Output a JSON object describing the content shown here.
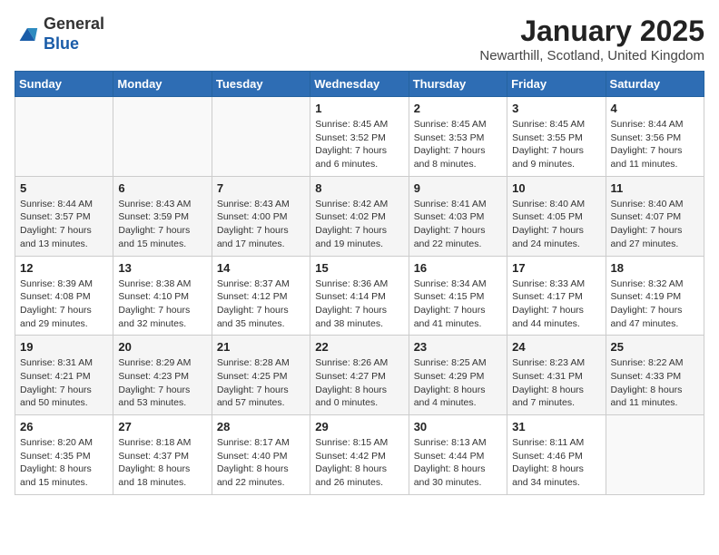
{
  "logo": {
    "general": "General",
    "blue": "Blue"
  },
  "title": "January 2025",
  "location": "Newarthill, Scotland, United Kingdom",
  "weekdays": [
    "Sunday",
    "Monday",
    "Tuesday",
    "Wednesday",
    "Thursday",
    "Friday",
    "Saturday"
  ],
  "weeks": [
    [
      {
        "day": "",
        "info": ""
      },
      {
        "day": "",
        "info": ""
      },
      {
        "day": "",
        "info": ""
      },
      {
        "day": "1",
        "info": "Sunrise: 8:45 AM\nSunset: 3:52 PM\nDaylight: 7 hours and 6 minutes."
      },
      {
        "day": "2",
        "info": "Sunrise: 8:45 AM\nSunset: 3:53 PM\nDaylight: 7 hours and 8 minutes."
      },
      {
        "day": "3",
        "info": "Sunrise: 8:45 AM\nSunset: 3:55 PM\nDaylight: 7 hours and 9 minutes."
      },
      {
        "day": "4",
        "info": "Sunrise: 8:44 AM\nSunset: 3:56 PM\nDaylight: 7 hours and 11 minutes."
      }
    ],
    [
      {
        "day": "5",
        "info": "Sunrise: 8:44 AM\nSunset: 3:57 PM\nDaylight: 7 hours and 13 minutes."
      },
      {
        "day": "6",
        "info": "Sunrise: 8:43 AM\nSunset: 3:59 PM\nDaylight: 7 hours and 15 minutes."
      },
      {
        "day": "7",
        "info": "Sunrise: 8:43 AM\nSunset: 4:00 PM\nDaylight: 7 hours and 17 minutes."
      },
      {
        "day": "8",
        "info": "Sunrise: 8:42 AM\nSunset: 4:02 PM\nDaylight: 7 hours and 19 minutes."
      },
      {
        "day": "9",
        "info": "Sunrise: 8:41 AM\nSunset: 4:03 PM\nDaylight: 7 hours and 22 minutes."
      },
      {
        "day": "10",
        "info": "Sunrise: 8:40 AM\nSunset: 4:05 PM\nDaylight: 7 hours and 24 minutes."
      },
      {
        "day": "11",
        "info": "Sunrise: 8:40 AM\nSunset: 4:07 PM\nDaylight: 7 hours and 27 minutes."
      }
    ],
    [
      {
        "day": "12",
        "info": "Sunrise: 8:39 AM\nSunset: 4:08 PM\nDaylight: 7 hours and 29 minutes."
      },
      {
        "day": "13",
        "info": "Sunrise: 8:38 AM\nSunset: 4:10 PM\nDaylight: 7 hours and 32 minutes."
      },
      {
        "day": "14",
        "info": "Sunrise: 8:37 AM\nSunset: 4:12 PM\nDaylight: 7 hours and 35 minutes."
      },
      {
        "day": "15",
        "info": "Sunrise: 8:36 AM\nSunset: 4:14 PM\nDaylight: 7 hours and 38 minutes."
      },
      {
        "day": "16",
        "info": "Sunrise: 8:34 AM\nSunset: 4:15 PM\nDaylight: 7 hours and 41 minutes."
      },
      {
        "day": "17",
        "info": "Sunrise: 8:33 AM\nSunset: 4:17 PM\nDaylight: 7 hours and 44 minutes."
      },
      {
        "day": "18",
        "info": "Sunrise: 8:32 AM\nSunset: 4:19 PM\nDaylight: 7 hours and 47 minutes."
      }
    ],
    [
      {
        "day": "19",
        "info": "Sunrise: 8:31 AM\nSunset: 4:21 PM\nDaylight: 7 hours and 50 minutes."
      },
      {
        "day": "20",
        "info": "Sunrise: 8:29 AM\nSunset: 4:23 PM\nDaylight: 7 hours and 53 minutes."
      },
      {
        "day": "21",
        "info": "Sunrise: 8:28 AM\nSunset: 4:25 PM\nDaylight: 7 hours and 57 minutes."
      },
      {
        "day": "22",
        "info": "Sunrise: 8:26 AM\nSunset: 4:27 PM\nDaylight: 8 hours and 0 minutes."
      },
      {
        "day": "23",
        "info": "Sunrise: 8:25 AM\nSunset: 4:29 PM\nDaylight: 8 hours and 4 minutes."
      },
      {
        "day": "24",
        "info": "Sunrise: 8:23 AM\nSunset: 4:31 PM\nDaylight: 8 hours and 7 minutes."
      },
      {
        "day": "25",
        "info": "Sunrise: 8:22 AM\nSunset: 4:33 PM\nDaylight: 8 hours and 11 minutes."
      }
    ],
    [
      {
        "day": "26",
        "info": "Sunrise: 8:20 AM\nSunset: 4:35 PM\nDaylight: 8 hours and 15 minutes."
      },
      {
        "day": "27",
        "info": "Sunrise: 8:18 AM\nSunset: 4:37 PM\nDaylight: 8 hours and 18 minutes."
      },
      {
        "day": "28",
        "info": "Sunrise: 8:17 AM\nSunset: 4:40 PM\nDaylight: 8 hours and 22 minutes."
      },
      {
        "day": "29",
        "info": "Sunrise: 8:15 AM\nSunset: 4:42 PM\nDaylight: 8 hours and 26 minutes."
      },
      {
        "day": "30",
        "info": "Sunrise: 8:13 AM\nSunset: 4:44 PM\nDaylight: 8 hours and 30 minutes."
      },
      {
        "day": "31",
        "info": "Sunrise: 8:11 AM\nSunset: 4:46 PM\nDaylight: 8 hours and 34 minutes."
      },
      {
        "day": "",
        "info": ""
      }
    ]
  ]
}
